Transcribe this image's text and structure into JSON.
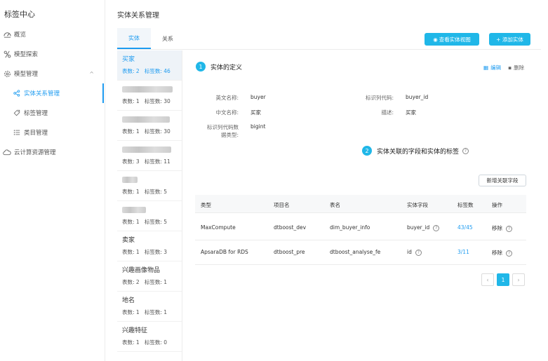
{
  "sidebar": {
    "title": "标签中心",
    "items": [
      {
        "label": "概览",
        "icon": "dashboard-icon"
      },
      {
        "label": "模型探索",
        "icon": "explore-icon"
      },
      {
        "label": "模型管理",
        "icon": "gear-icon",
        "arrow": "^"
      },
      {
        "label": "实体关系管理",
        "icon": "share-icon"
      },
      {
        "label": "标签管理",
        "icon": "tag-icon"
      },
      {
        "label": "类目管理",
        "icon": "list-icon"
      },
      {
        "label": "云计算资源管理",
        "icon": "cloud-icon"
      }
    ]
  },
  "page": {
    "title": "实体关系管理"
  },
  "tabs": [
    "实体",
    "关系"
  ],
  "actions": {
    "view_diagram": "查看实体视图",
    "add_entity": "+ 添加实体"
  },
  "entities": [
    {
      "name": "买家",
      "tables": "表数: 2",
      "tags": "标签数: 46"
    },
    {
      "name": "",
      "tables": "表数: 1",
      "tags": "标签数: 30"
    },
    {
      "name": "",
      "tables": "表数: 1",
      "tags": "标签数: 30"
    },
    {
      "name": "",
      "tables": "表数: 3",
      "tags": "标签数: 11"
    },
    {
      "name": "",
      "tables": "表数: 1",
      "tags": "标签数: 5"
    },
    {
      "name": "",
      "tables": "表数: 1",
      "tags": "标签数: 5"
    },
    {
      "name": "卖家",
      "tables": "表数: 1",
      "tags": "标签数: 3"
    },
    {
      "name": "兴趣画像物品",
      "tables": "表数: 2",
      "tags": "标签数: 1"
    },
    {
      "name": "地名",
      "tables": "表数: 1",
      "tags": "标签数: 1"
    },
    {
      "name": "兴趣特征",
      "tables": "表数: 1",
      "tags": "标签数: 0"
    }
  ],
  "definition": {
    "step": "1",
    "title": "实体的定义",
    "edit": "编辑",
    "delete": "删除",
    "fields": [
      {
        "label": "英文名称:",
        "value": "buyer"
      },
      {
        "label": "中文名称:",
        "value": "买家"
      },
      {
        "label": "标识列代码数据类型:",
        "label_line1": "标识列代码数",
        "label_line2": "据类型:",
        "value": "bigint"
      },
      {
        "label": "标识列代码:",
        "value": "buyer_id"
      },
      {
        "label": "描述:",
        "value": "买家"
      }
    ]
  },
  "related": {
    "step": "2",
    "title": "实体关联的字段和实体的标签",
    "add_field": "新增关联字段"
  },
  "table": {
    "headers": [
      "类型",
      "项目名",
      "表名",
      "实体字段",
      "标签数",
      "操作"
    ],
    "rows": [
      {
        "type": "MaxCompute",
        "project": "dtboost_dev",
        "table": "dim_buyer_info",
        "field": "buyer_id",
        "tags": "43/45",
        "action": "移除"
      },
      {
        "type": "ApsaraDB for RDS",
        "project": "dtboost_pre",
        "table": "dtboost_analyse_fe",
        "field": "id",
        "tags": "3/11",
        "action": "移除"
      }
    ]
  },
  "pagination": {
    "prev": "‹",
    "current": "1",
    "next": "›"
  },
  "colors": {
    "accent": "#1d9bf0",
    "primary_button": "#20b7e8"
  }
}
